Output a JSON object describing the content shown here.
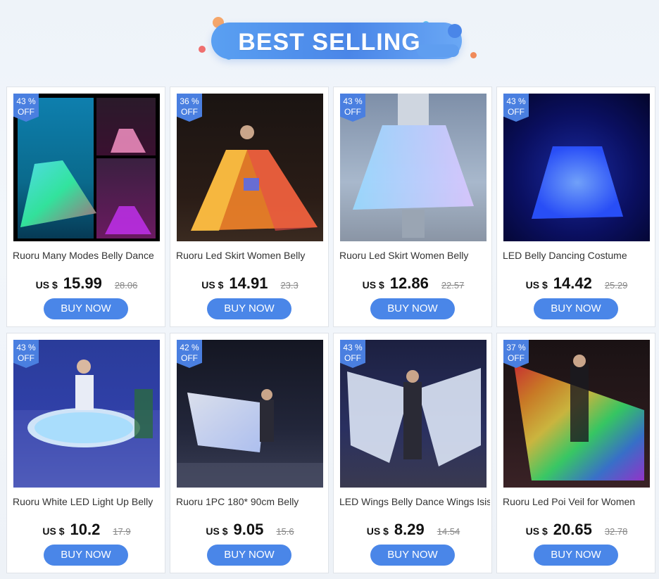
{
  "banner": {
    "title": "BEST SELLING"
  },
  "products": [
    {
      "discount": "43 %",
      "off": "OFF",
      "title": "Ruoru Many Modes Belly Dance",
      "currency": "US $",
      "price": "15.99",
      "old_price": "28.06",
      "button": "BUY NOW"
    },
    {
      "discount": "36 %",
      "off": "OFF",
      "title": "Ruoru Led Skirt Women Belly",
      "currency": "US $",
      "price": "14.91",
      "old_price": "23.3",
      "button": "BUY NOW"
    },
    {
      "discount": "43 %",
      "off": "OFF",
      "title": "Ruoru Led Skirt Women Belly",
      "currency": "US $",
      "price": "12.86",
      "old_price": "22.57",
      "button": "BUY NOW"
    },
    {
      "discount": "43 %",
      "off": "OFF",
      "title": "LED Belly Dancing Costume",
      "currency": "US $",
      "price": "14.42",
      "old_price": "25.29",
      "button": "BUY NOW"
    },
    {
      "discount": "43 %",
      "off": "OFF",
      "title": "Ruoru White LED Light Up Belly",
      "currency": "US $",
      "price": "10.2",
      "old_price": "17.9",
      "button": "BUY NOW"
    },
    {
      "discount": "42 %",
      "off": "OFF",
      "title": "Ruoru 1PC 180* 90cm Belly",
      "currency": "US $",
      "price": "9.05",
      "old_price": "15.6",
      "button": "BUY NOW"
    },
    {
      "discount": "43 %",
      "off": "OFF",
      "title": "LED Wings Belly Dance Wings Isis",
      "currency": "US $",
      "price": "8.29",
      "old_price": "14.54",
      "button": "BUY NOW"
    },
    {
      "discount": "37 %",
      "off": "OFF",
      "title": "Ruoru Led Poi Veil for Women",
      "currency": "US $",
      "price": "20.65",
      "old_price": "32.78",
      "button": "BUY NOW"
    }
  ],
  "colors": {
    "accent": "#4a86e8",
    "badge": "#4a7fe0"
  }
}
